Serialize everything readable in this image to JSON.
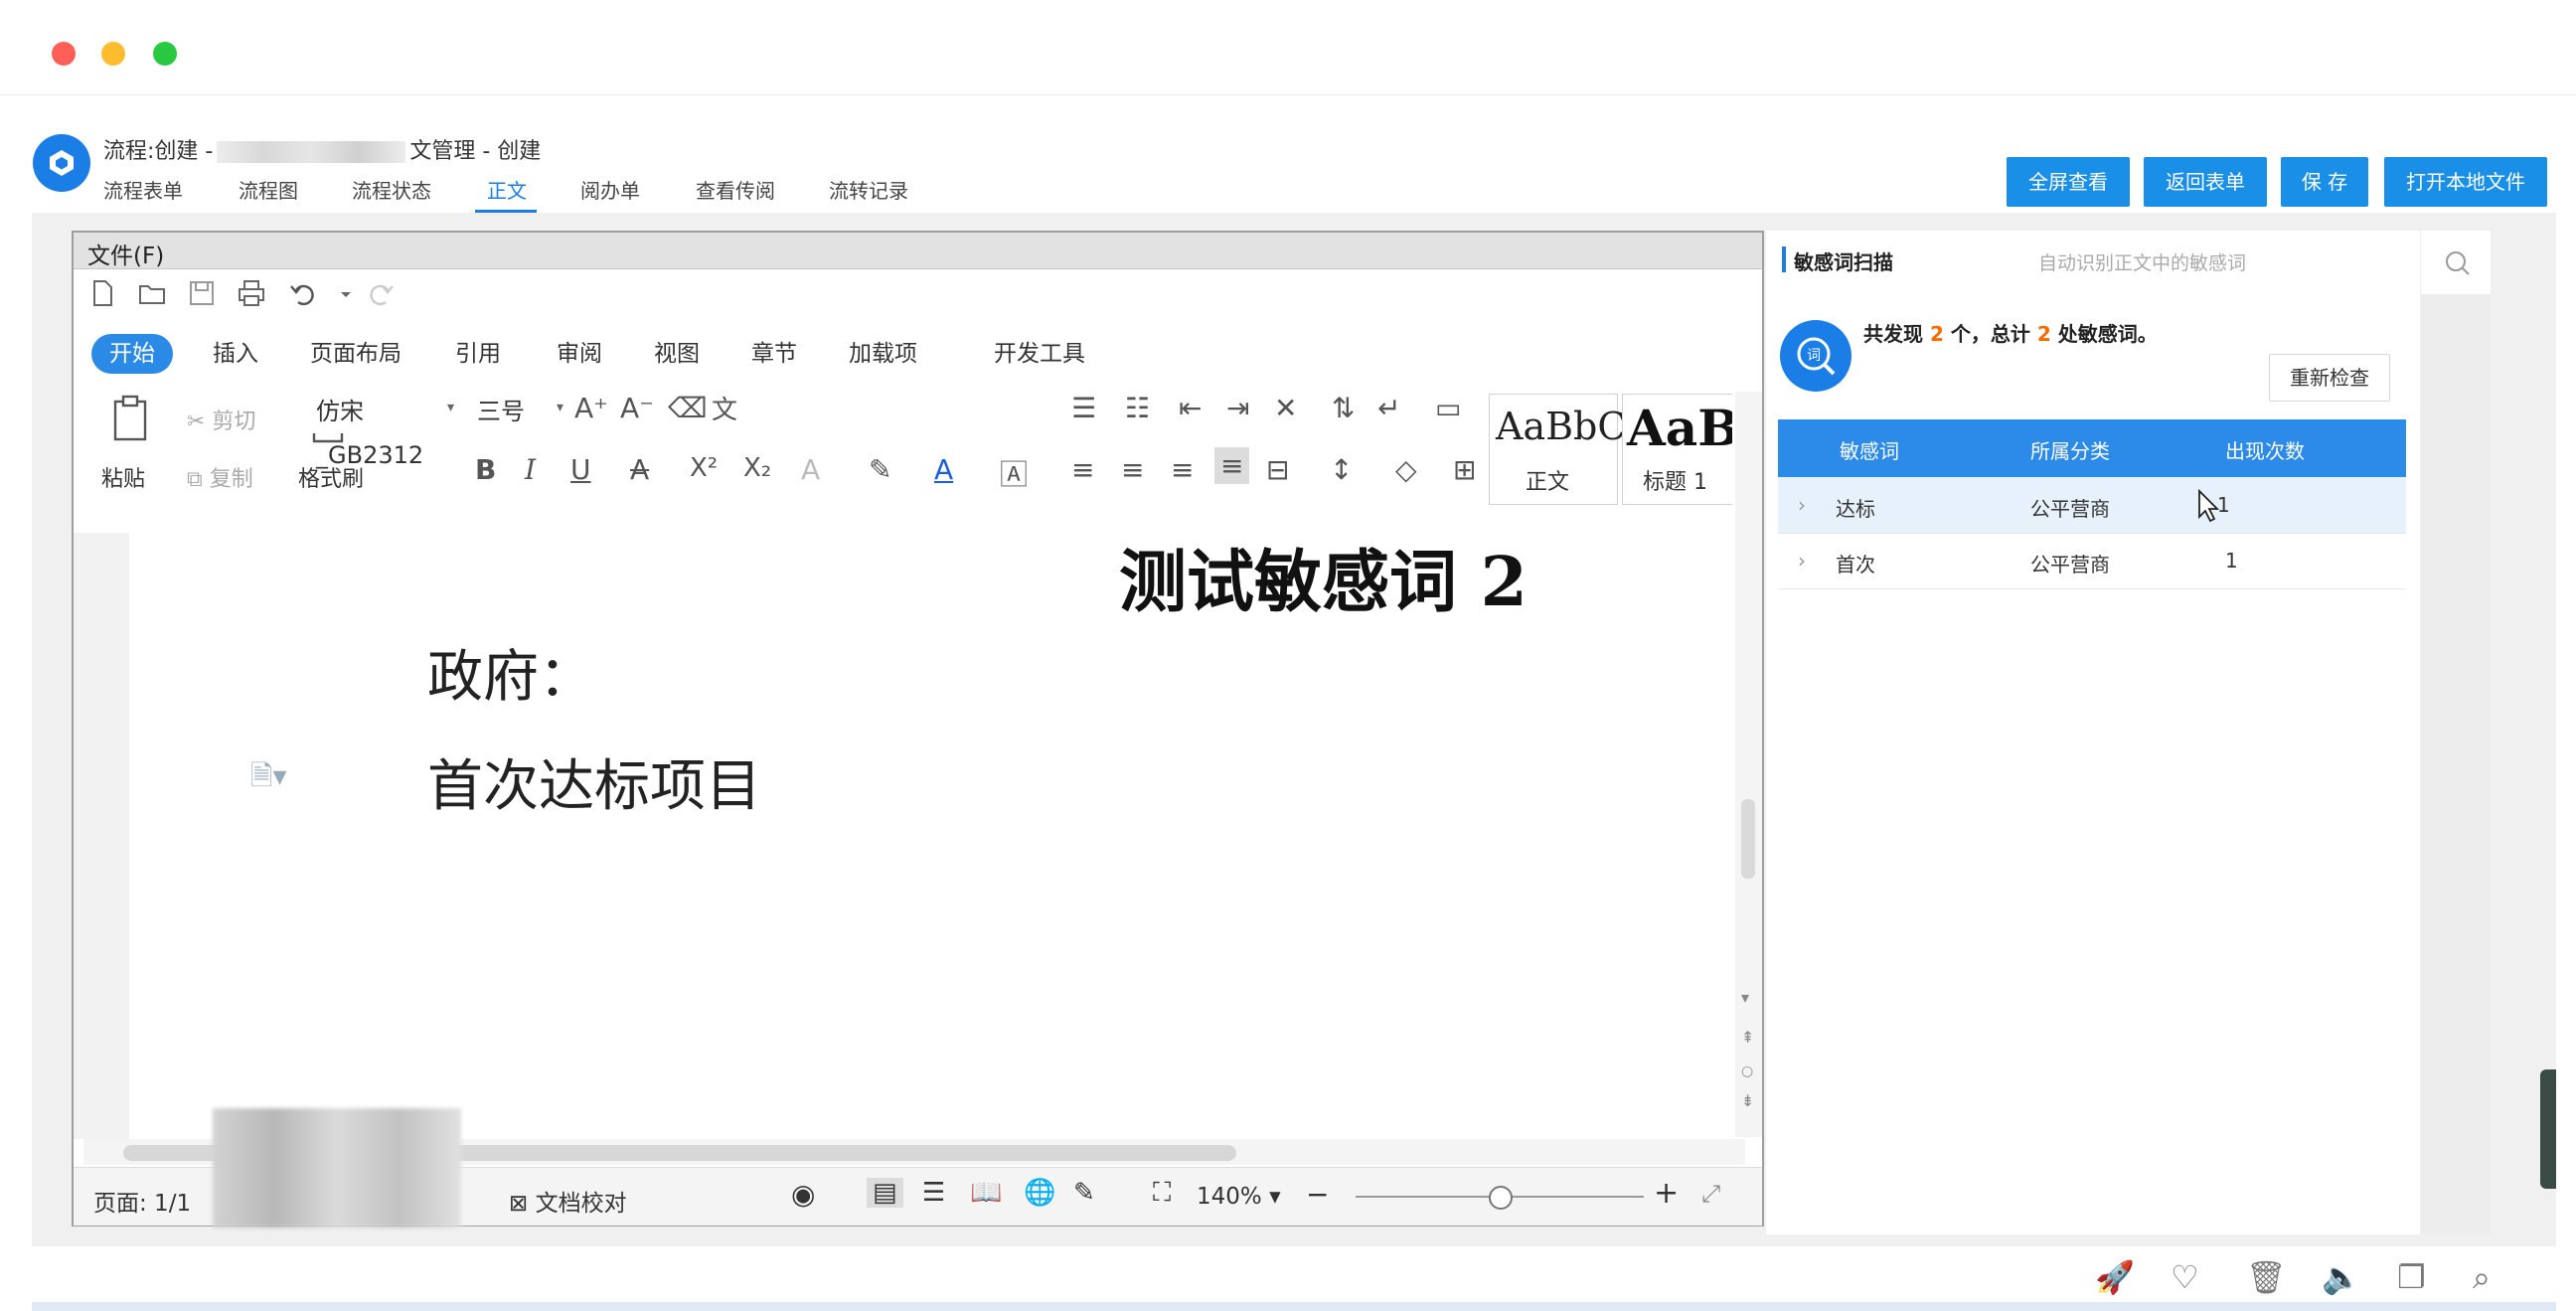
{
  "window": {
    "dots": [
      "#ff5f57",
      "#febc2e",
      "#28c840"
    ]
  },
  "header": {
    "title_prefix": "流程:创建 -",
    "title_suffix": "文管理 - 创建",
    "tabs": [
      {
        "label": "流程表单"
      },
      {
        "label": "流程图"
      },
      {
        "label": "流程状态"
      },
      {
        "label": "正文",
        "active": true
      },
      {
        "label": "阅办单"
      },
      {
        "label": "查看传阅"
      },
      {
        "label": "流转记录"
      }
    ],
    "buttons": {
      "fullscreen": "全屏查看",
      "back": "返回表单",
      "save": "保 存",
      "open_local": "打开本地文件"
    }
  },
  "editor": {
    "menu_file": "文件(F)",
    "ribbon_tabs": [
      "开始",
      "插入",
      "页面布局",
      "引用",
      "审阅",
      "视图",
      "章节",
      "加载项",
      "开发工具"
    ],
    "clipboard": {
      "paste": "粘贴",
      "cut": "剪切",
      "copy": "复制",
      "format_painter": "格式刷"
    },
    "font_name": "仿宋_GB2312",
    "font_size": "三号",
    "styles": {
      "normal_preview": "AaBbC",
      "normal_label": "正文",
      "heading_preview": "AaB",
      "heading_label": "标题 1"
    },
    "document": {
      "heading": "测试敏感词 2",
      "line1": "政府：",
      "line2": "首次达标项目"
    },
    "status": {
      "page": "页面: 1/1",
      "proofread": "文档校对",
      "zoom": "140%",
      "zoom_minus": "−",
      "zoom_plus": "+"
    }
  },
  "panel": {
    "title": "敏感词扫描",
    "subtitle": "自动识别正文中的敏感词",
    "summary_prefix": "共发现",
    "count_found": "2",
    "summary_mid": "个，总计",
    "count_total": "2",
    "summary_suffix": "处敏感词。",
    "recheck": "重新检查",
    "columns": [
      "敏感词",
      "所属分类",
      "出现次数"
    ],
    "rows": [
      {
        "word": "达标",
        "category": "公平营商",
        "count": "1"
      },
      {
        "word": "首次",
        "category": "公平营商",
        "count": "1"
      }
    ],
    "accent": "#2c8ae8",
    "highlight_count": "#ff6a00"
  },
  "bottom_icons": [
    "rocket-icon",
    "heart-pulse-icon",
    "trash-icon",
    "speaker-icon",
    "copy-icon",
    "search-icon"
  ]
}
